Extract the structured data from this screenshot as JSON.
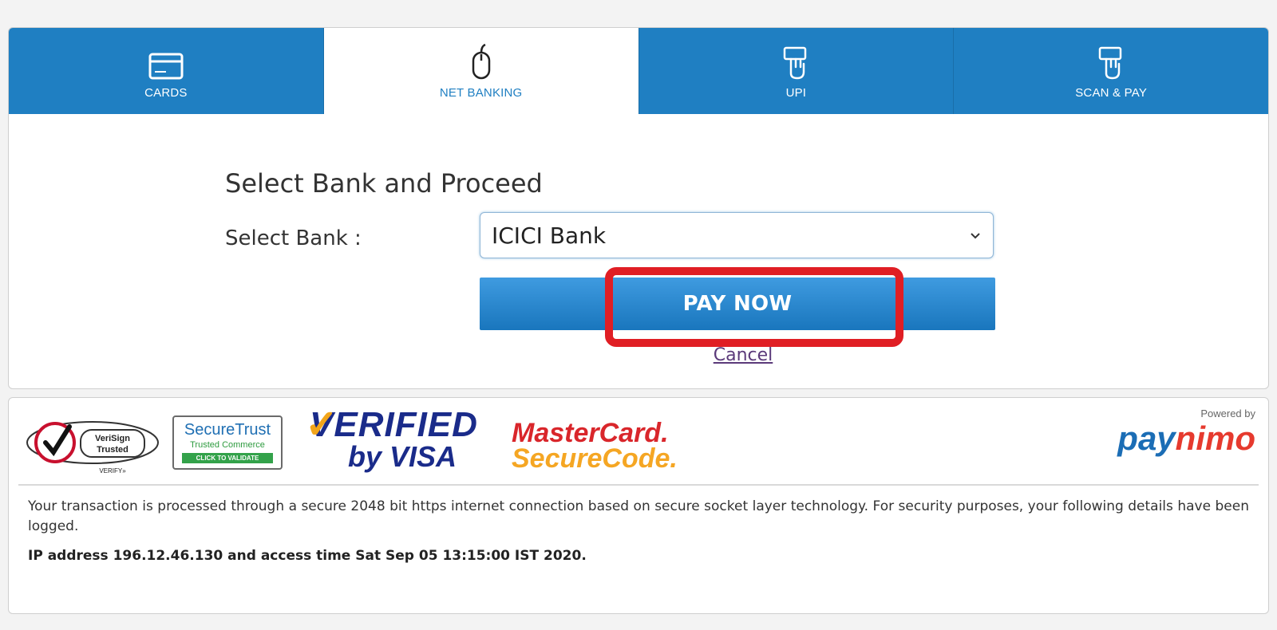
{
  "tabs": [
    {
      "label": "CARDS",
      "icon": "card-icon"
    },
    {
      "label": "NET BANKING",
      "icon": "mouse-icon"
    },
    {
      "label": "UPI",
      "icon": "hand-tap-icon"
    },
    {
      "label": "SCAN & PAY",
      "icon": "hand-tap-icon"
    }
  ],
  "form": {
    "heading": "Select Bank and Proceed",
    "bank_label": "Select Bank :",
    "bank_value": "ICICI Bank",
    "pay_label": "PAY NOW",
    "cancel_label": "Cancel"
  },
  "security": {
    "verisign_line1": "VeriSign",
    "verisign_line2": "Trusted",
    "verisign_verify": "VERIFY»",
    "securetrust_title": "SecureTrust",
    "securetrust_sub": "Trusted Commerce",
    "securetrust_btn": "CLICK TO VALIDATE",
    "visa_top": "VERIFIED",
    "visa_bottom": "by VISA",
    "mc_top": "MasterCard.",
    "mc_bottom": "SecureCode.",
    "powered_by": "Powered by",
    "brand_part1": "pay",
    "brand_part2": "nimo",
    "info_text": "Your transaction is processed through a secure 2048 bit https internet connection based on secure socket layer technology. For security purposes, your following details have been logged.",
    "ip_text": "IP address 196.12.46.130 and access time Sat Sep 05 13:15:00 IST 2020."
  },
  "colors": {
    "tab_blue": "#1f7fc2",
    "highlight_red": "#e01e24"
  }
}
